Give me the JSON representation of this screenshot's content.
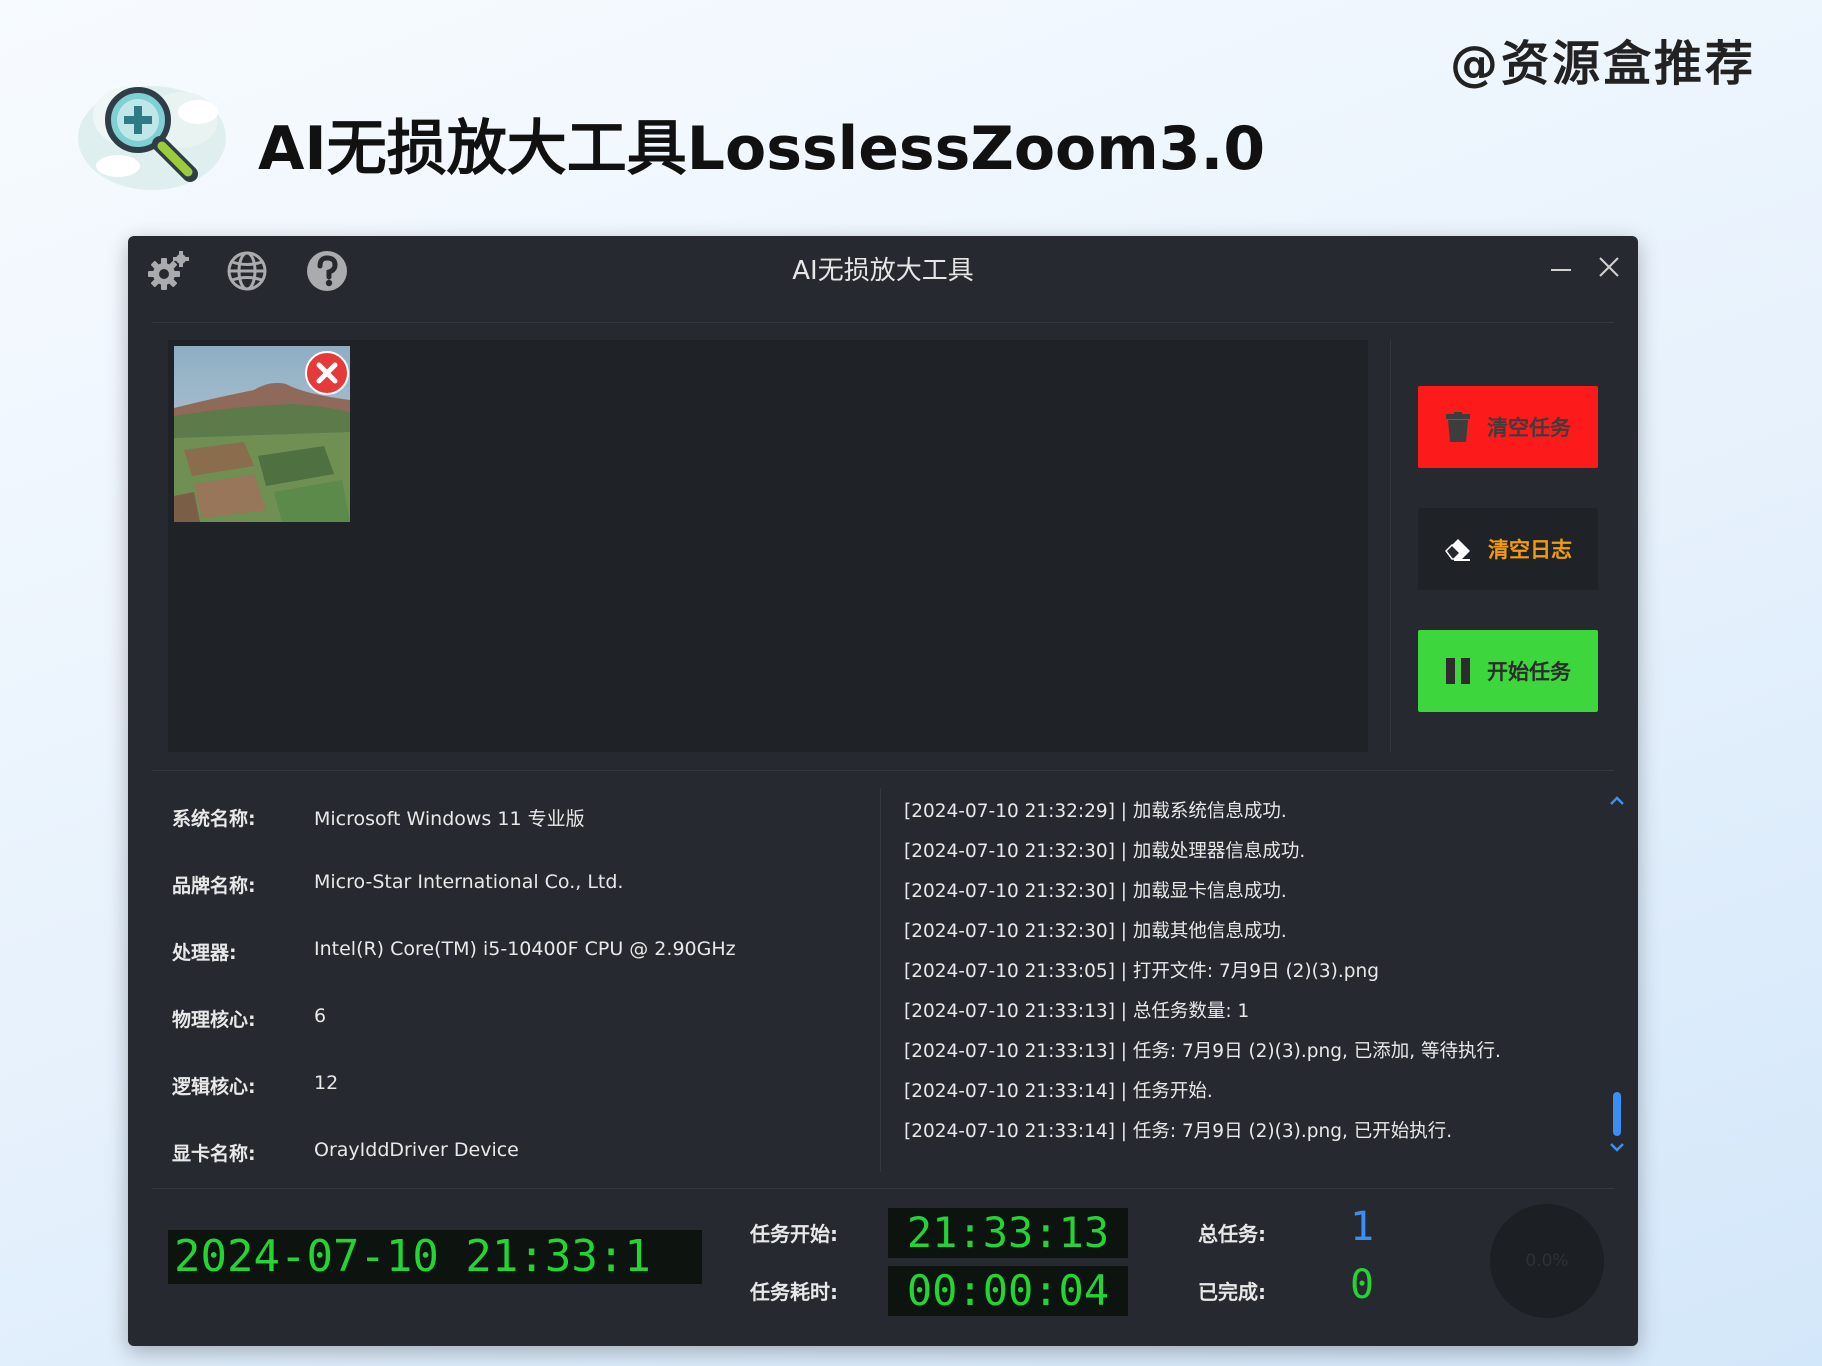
{
  "page_tag": "@资源盒推荐",
  "headline": "AI无损放大工具LosslessZoom3.0",
  "window": {
    "title": "AI无损放大工具",
    "toolbar_icons": [
      "settings-icon",
      "language-globe-icon",
      "help-icon"
    ],
    "controls": [
      "minimize-icon",
      "close-icon"
    ]
  },
  "thumbnails": [
    {
      "name": "7月9日 (2)(3).png",
      "icon": "remove-icon"
    }
  ],
  "actions": {
    "clear_tasks": {
      "label": "清空任务",
      "icon": "trash-icon",
      "bg": "#fc1a1a",
      "fg": "#3d3d3d"
    },
    "clear_log": {
      "label": "清空日志",
      "icon": "eraser-icon",
      "bg": "#1f2227",
      "fg": "#f29c0d"
    },
    "start_task": {
      "label": "开始任务",
      "icon": "pause-icon",
      "bg": "#3ed63d",
      "fg": "#2c2c2c"
    }
  },
  "system_info": [
    {
      "label": "系统名称:",
      "value": "Microsoft Windows 11 专业版"
    },
    {
      "label": "品牌名称:",
      "value": "Micro-Star International Co., Ltd."
    },
    {
      "label": "处理器:",
      "value": "Intel(R) Core(TM) i5-10400F CPU @ 2.90GHz"
    },
    {
      "label": "物理核心:",
      "value": "6"
    },
    {
      "label": "逻辑核心:",
      "value": "12"
    },
    {
      "label": "显卡名称:",
      "value": "OrayIddDriver Device"
    }
  ],
  "log": [
    "[2024-07-10 21:32:29] | 加载系统信息成功.",
    "[2024-07-10 21:32:30] | 加载处理器信息成功.",
    "[2024-07-10 21:32:30] | 加载显卡信息成功.",
    "[2024-07-10 21:32:30] | 加载其他信息成功.",
    "[2024-07-10 21:33:05] | 打开文件: 7月9日 (2)(3).png",
    "[2024-07-10 21:33:13] | 总任务数量: 1",
    "[2024-07-10 21:33:13] | 任务: 7月9日 (2)(3).png, 已添加, 等待执行.",
    "[2024-07-10 21:33:14] | 任务开始.",
    "[2024-07-10 21:33:14] | 任务: 7月9日 (2)(3).png, 已开始执行."
  ],
  "status": {
    "clock": "2024-07-10 21:33:1",
    "task_start_label": "任务开始:",
    "task_start": "21:33:13",
    "elapsed_label": "任务耗时:",
    "elapsed": "00:00:04",
    "total_label": "总任务:",
    "total": "1",
    "done_label": "已完成:",
    "done": "0",
    "progress": "0.0%",
    "colors": {
      "lcd": "#23d433",
      "total": "#3b8ff2",
      "done": "#23d433"
    }
  }
}
